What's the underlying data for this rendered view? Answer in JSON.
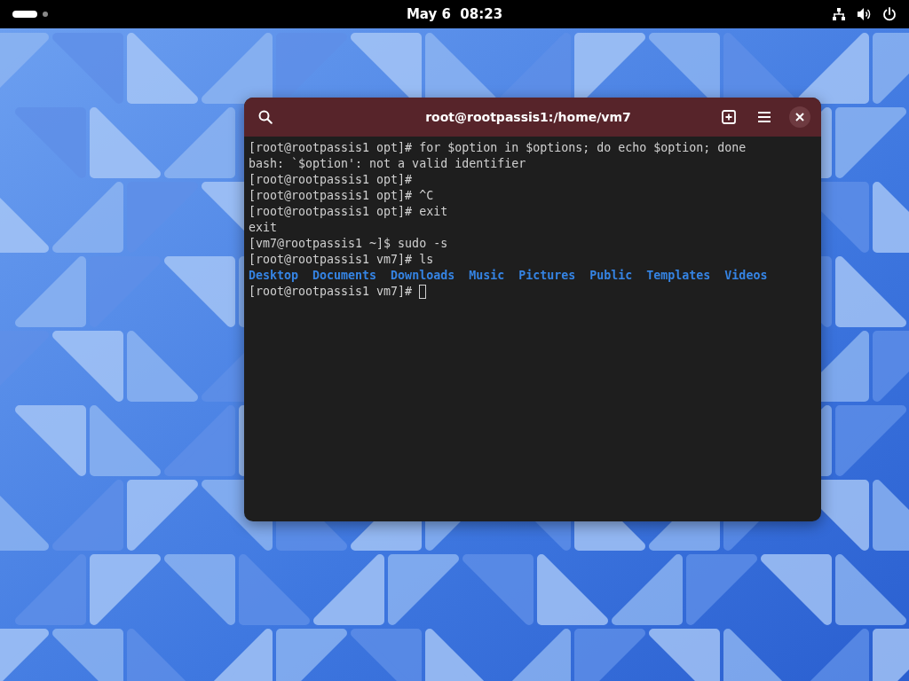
{
  "top_bar": {
    "clock": "May 6  08:23"
  },
  "terminal": {
    "title": "root@rootpassis1:/home/vm7",
    "lines": [
      {
        "kind": "text",
        "text": "[root@rootpassis1 opt]# for $option in $options; do echo $option; done"
      },
      {
        "kind": "text",
        "text": "bash: `$option': not a valid identifier"
      },
      {
        "kind": "text",
        "text": "[root@rootpassis1 opt]#"
      },
      {
        "kind": "text",
        "text": "[root@rootpassis1 opt]# ^C"
      },
      {
        "kind": "text",
        "text": "[root@rootpassis1 opt]# exit"
      },
      {
        "kind": "text",
        "text": "exit"
      },
      {
        "kind": "text",
        "text": "[vm7@rootpassis1 ~]$ sudo -s"
      },
      {
        "kind": "text",
        "text": "[root@rootpassis1 vm7]# ls"
      },
      {
        "kind": "listing",
        "items": [
          "Desktop",
          "Documents",
          "Downloads",
          "Music",
          "Pictures",
          "Public",
          "Templates",
          "Videos"
        ]
      },
      {
        "kind": "prompt",
        "text": "[root@rootpassis1 vm7]#"
      }
    ]
  }
}
